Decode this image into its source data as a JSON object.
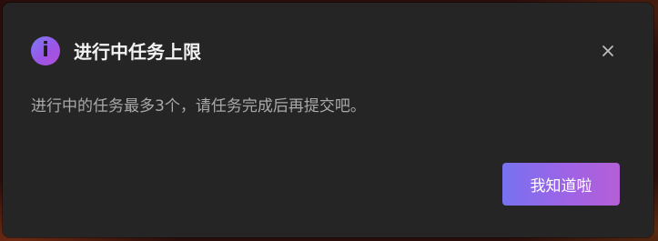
{
  "dialog": {
    "title": "进行中任务上限",
    "message": "进行中的任务最多3个，请任务完成后再提交吧。",
    "confirm_label": "我知道啦",
    "icon": "info-icon",
    "close_icon": "close-icon",
    "info_glyph": "i"
  },
  "colors": {
    "dialog_background": "#252525",
    "title_text": "#f2f2f2",
    "message_text": "#a9a9a9",
    "accent_start": "#7772f0",
    "accent_end": "#b45fd6"
  }
}
